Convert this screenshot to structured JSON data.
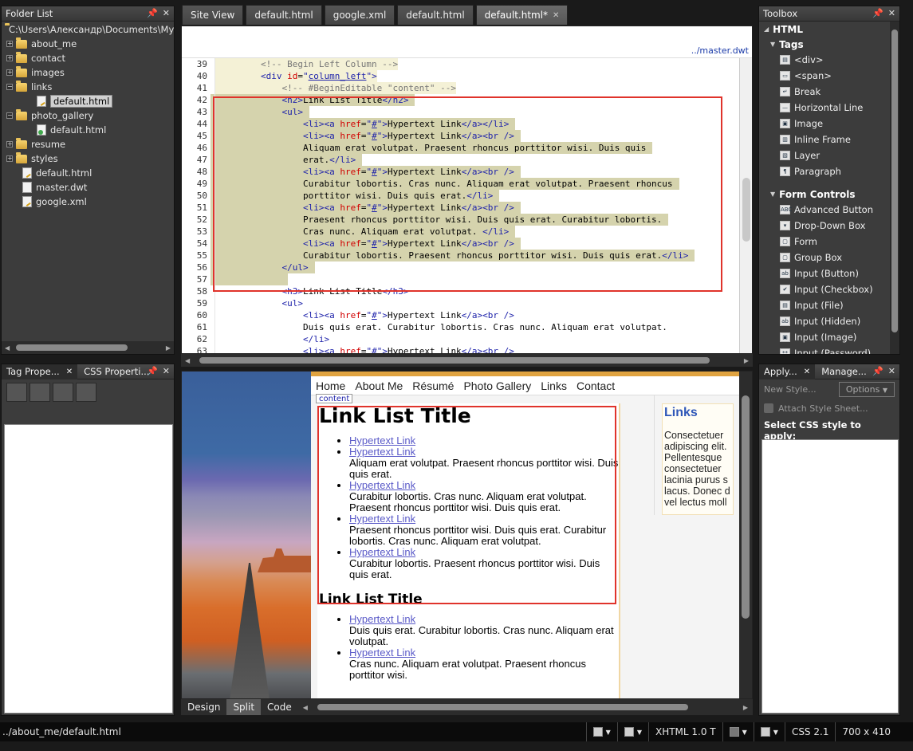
{
  "folder_list": {
    "title": "Folder List",
    "items": [
      {
        "label": "C:\\Users\\Александр\\Documents\\My We",
        "type": "root"
      },
      {
        "label": "about_me",
        "type": "folder",
        "expander": "+"
      },
      {
        "label": "contact",
        "type": "folder",
        "expander": "+"
      },
      {
        "label": "images",
        "type": "folder",
        "expander": "+"
      },
      {
        "label": "links",
        "type": "folder",
        "expander": "−"
      },
      {
        "label": "default.html",
        "type": "file-selected"
      },
      {
        "label": "photo_gallery",
        "type": "folder",
        "expander": "−"
      },
      {
        "label": "default.html",
        "type": "file-green"
      },
      {
        "label": "resume",
        "type": "folder",
        "expander": "+"
      },
      {
        "label": "styles",
        "type": "folder",
        "expander": "+"
      },
      {
        "label": "default.html",
        "type": "file-html"
      },
      {
        "label": "master.dwt",
        "type": "file"
      },
      {
        "label": "google.xml",
        "type": "file-html"
      }
    ]
  },
  "tag_properties": {
    "tab1": "Tag Prope...",
    "tab2": "CSS Properti..."
  },
  "doc_tabs": [
    {
      "label": "Site View",
      "active": false
    },
    {
      "label": "default.html",
      "active": false
    },
    {
      "label": "google.xml",
      "active": false
    },
    {
      "label": "default.html",
      "active": false
    },
    {
      "label": "default.html*",
      "active": true
    }
  ],
  "code_view": {
    "master_link": "../master.dwt",
    "lines": [
      {
        "n": "39",
        "text": "        <!-- Begin Left Column -->"
      },
      {
        "n": "40",
        "text": "        <div id=\"column_left\">"
      },
      {
        "n": "41",
        "text": "            <!-- #BeginEditable \"content\" -->"
      },
      {
        "n": "42",
        "text": "            <h2>Link List Title</h2>"
      },
      {
        "n": "43",
        "text": "            <ul>"
      },
      {
        "n": "44",
        "text": "                <li><a href=\"#\">Hypertext Link</a></li>"
      },
      {
        "n": "45",
        "text": "                <li><a href=\"#\">Hypertext Link</a><br />"
      },
      {
        "n": "46",
        "text": "                Aliquam erat volutpat. Praesent rhoncus porttitor wisi. Duis quis"
      },
      {
        "n": "47",
        "text": "                erat.</li>"
      },
      {
        "n": "48",
        "text": "                <li><a href=\"#\">Hypertext Link</a><br />"
      },
      {
        "n": "49",
        "text": "                Curabitur lobortis. Cras nunc. Aliquam erat volutpat. Praesent rhoncus"
      },
      {
        "n": "50",
        "text": "                porttitor wisi. Duis quis erat.</li>"
      },
      {
        "n": "51",
        "text": "                <li><a href=\"#\">Hypertext Link</a><br />"
      },
      {
        "n": "52",
        "text": "                Praesent rhoncus porttitor wisi. Duis quis erat. Curabitur lobortis."
      },
      {
        "n": "53",
        "text": "                Cras nunc. Aliquam erat volutpat. </li>"
      },
      {
        "n": "54",
        "text": "                <li><a href=\"#\">Hypertext Link</a><br />"
      },
      {
        "n": "55",
        "text": "                Curabitur lobortis. Praesent rhoncus porttitor wisi. Duis quis erat.</li>"
      },
      {
        "n": "56",
        "text": "            </ul>"
      },
      {
        "n": "57",
        "text": "            "
      },
      {
        "n": "58",
        "text": "            <h3>Link List Title</h3>"
      },
      {
        "n": "59",
        "text": "            <ul>"
      },
      {
        "n": "60",
        "text": "                <li><a href=\"#\">Hypertext Link</a><br />"
      },
      {
        "n": "61",
        "text": "                Duis quis erat. Curabitur lobortis. Cras nunc. Aliquam erat volutpat."
      },
      {
        "n": "62",
        "text": "                </li>"
      },
      {
        "n": "63",
        "text": "                <li><a href=\"#\">Hypertext Link</a><br />"
      }
    ]
  },
  "design_view": {
    "nav": [
      "Home",
      "About Me",
      "Résumé",
      "Photo Gallery",
      "Links",
      "Contact"
    ],
    "content_tag": "content",
    "h2": "Link List Title",
    "list1": [
      {
        "link": "Hypertext Link",
        "text": ""
      },
      {
        "link": "Hypertext Link",
        "text": "Aliquam erat volutpat. Praesent rhoncus porttitor wisi. Duis quis erat."
      },
      {
        "link": "Hypertext Link",
        "text": "Curabitur lobortis. Cras nunc. Aliquam erat volutpat. Praesent rhoncus porttitor wisi. Duis quis erat."
      },
      {
        "link": "Hypertext Link",
        "text": "Praesent rhoncus porttitor wisi. Duis quis erat. Curabitur lobortis. Cras nunc. Aliquam erat volutpat."
      },
      {
        "link": "Hypertext Link",
        "text": "Curabitur lobortis. Praesent rhoncus porttitor wisi. Duis quis erat."
      }
    ],
    "h3": "Link List Title",
    "list2": [
      {
        "link": "Hypertext Link",
        "text": "Duis quis erat. Curabitur lobortis. Cras nunc. Aliquam erat volutpat."
      },
      {
        "link": "Hypertext Link",
        "text": "Cras nunc. Aliquam erat volutpat. Praesent rhoncus porttitor wisi."
      }
    ],
    "sidebar_title": "Links",
    "sidebar_lines": [
      "Consectetuer",
      "adipiscing elit.",
      "Pellentesque",
      "consectetuer",
      "lacinia purus s",
      "lacus. Donec d",
      "vel lectus moll"
    ]
  },
  "view_buttons": [
    {
      "label": "Design",
      "active": false
    },
    {
      "label": "Split",
      "active": true
    },
    {
      "label": "Code",
      "active": false
    }
  ],
  "toolbox": {
    "title": "Toolbox",
    "section": "HTML",
    "groups": [
      {
        "name": "Tags",
        "items": [
          {
            "label": "<div>",
            "icon": "div-icon",
            "glyph": "▤"
          },
          {
            "label": "<span>",
            "icon": "span-icon",
            "glyph": "▭"
          },
          {
            "label": "Break",
            "icon": "break-icon",
            "glyph": "↵"
          },
          {
            "label": "Horizontal Line",
            "icon": "hr-icon",
            "glyph": "—"
          },
          {
            "label": "Image",
            "icon": "image-icon",
            "glyph": "▣"
          },
          {
            "label": "Inline Frame",
            "icon": "iframe-icon",
            "glyph": "▥"
          },
          {
            "label": "Layer",
            "icon": "layer-icon",
            "glyph": "▧"
          },
          {
            "label": "Paragraph",
            "icon": "paragraph-icon",
            "glyph": "¶"
          }
        ]
      },
      {
        "name": "Form Controls",
        "items": [
          {
            "label": "Advanced Button",
            "icon": "advanced-button-icon",
            "glyph": "ABC"
          },
          {
            "label": "Drop-Down Box",
            "icon": "dropdown-icon",
            "glyph": "▾"
          },
          {
            "label": "Form",
            "icon": "form-icon",
            "glyph": "▢"
          },
          {
            "label": "Group Box",
            "icon": "groupbox-icon",
            "glyph": "▢"
          },
          {
            "label": "Input (Button)",
            "icon": "input-button-icon",
            "glyph": "ab"
          },
          {
            "label": "Input (Checkbox)",
            "icon": "checkbox-icon",
            "glyph": "✔"
          },
          {
            "label": "Input (File)",
            "icon": "input-file-icon",
            "glyph": "▤"
          },
          {
            "label": "Input (Hidden)",
            "icon": "input-hidden-icon",
            "glyph": "ab"
          },
          {
            "label": "Input (Image)",
            "icon": "input-image-icon",
            "glyph": "▣"
          },
          {
            "label": "Input (Password)",
            "icon": "input-password-icon",
            "glyph": "**"
          }
        ]
      }
    ]
  },
  "apply_styles": {
    "tab1": "Apply...",
    "tab2": "Manage...",
    "new_style": "New Style...",
    "options": "Options",
    "attach": "Attach Style Sheet...",
    "select_label": "Select CSS style to apply:"
  },
  "status_bar": {
    "path": "../about_me/default.html",
    "doctype": "XHTML 1.0 T",
    "css": "CSS 2.1",
    "size": "700 x 410"
  }
}
